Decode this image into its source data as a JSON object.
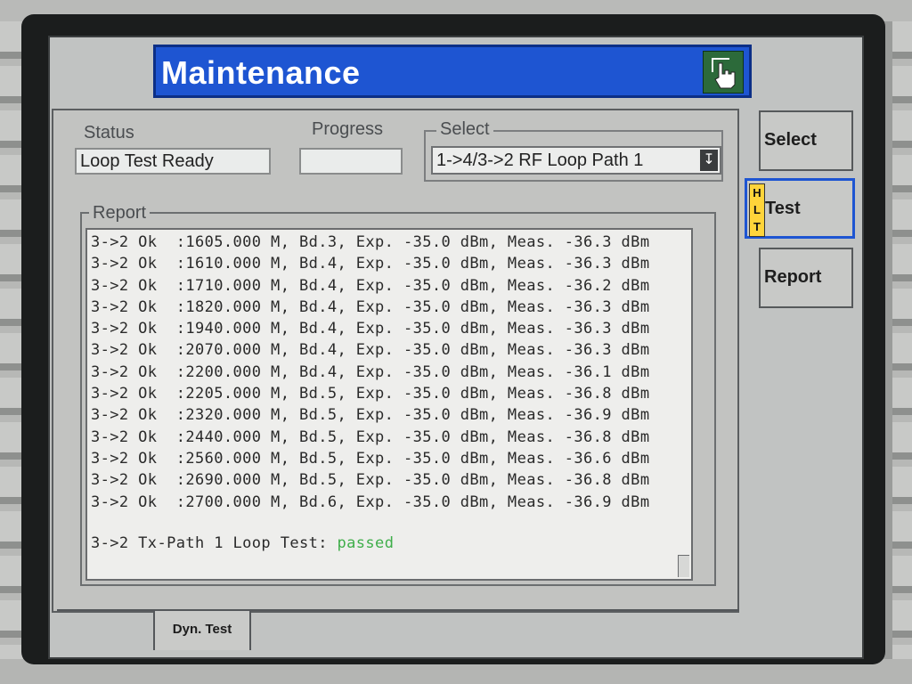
{
  "header": {
    "title": "Maintenance",
    "icon": "hand-pointer-icon"
  },
  "status": {
    "label": "Status",
    "value": "Loop Test Ready"
  },
  "progress": {
    "label": "Progress",
    "value": ""
  },
  "select": {
    "label": "Select",
    "value": "1->4/3->2 RF Loop Path 1",
    "arrow_icon": "down-arrow-icon"
  },
  "report": {
    "label": "Report",
    "lines": [
      "3->2 Ok  :1605.000 M, Bd.3, Exp. -35.0 dBm, Meas. -36.3 dBm",
      "3->2 Ok  :1610.000 M, Bd.4, Exp. -35.0 dBm, Meas. -36.3 dBm",
      "3->2 Ok  :1710.000 M, Bd.4, Exp. -35.0 dBm, Meas. -36.2 dBm",
      "3->2 Ok  :1820.000 M, Bd.4, Exp. -35.0 dBm, Meas. -36.3 dBm",
      "3->2 Ok  :1940.000 M, Bd.4, Exp. -35.0 dBm, Meas. -36.3 dBm",
      "3->2 Ok  :2070.000 M, Bd.4, Exp. -35.0 dBm, Meas. -36.3 dBm",
      "3->2 Ok  :2200.000 M, Bd.4, Exp. -35.0 dBm, Meas. -36.1 dBm",
      "3->2 Ok  :2205.000 M, Bd.5, Exp. -35.0 dBm, Meas. -36.8 dBm",
      "3->2 Ok  :2320.000 M, Bd.5, Exp. -35.0 dBm, Meas. -36.9 dBm",
      "3->2 Ok  :2440.000 M, Bd.5, Exp. -35.0 dBm, Meas. -36.8 dBm",
      "3->2 Ok  :2560.000 M, Bd.5, Exp. -35.0 dBm, Meas. -36.6 dBm",
      "3->2 Ok  :2690.000 M, Bd.5, Exp. -35.0 dBm, Meas. -36.8 dBm",
      "3->2 Ok  :2700.000 M, Bd.6, Exp. -35.0 dBm, Meas. -36.9 dBm"
    ],
    "result_prefix": "3->2 Tx-Path 1 Loop Test: ",
    "result_status": "passed"
  },
  "softkeys": {
    "select": "Select",
    "test": "Test",
    "test_badge": [
      "H",
      "L",
      "T"
    ],
    "report": "Report"
  },
  "tabs": {
    "dyn_test": "Dyn. Test"
  },
  "colors": {
    "title_bar": "#1e55d2",
    "passed": "#3fae4a",
    "badge": "#ffd43a"
  }
}
